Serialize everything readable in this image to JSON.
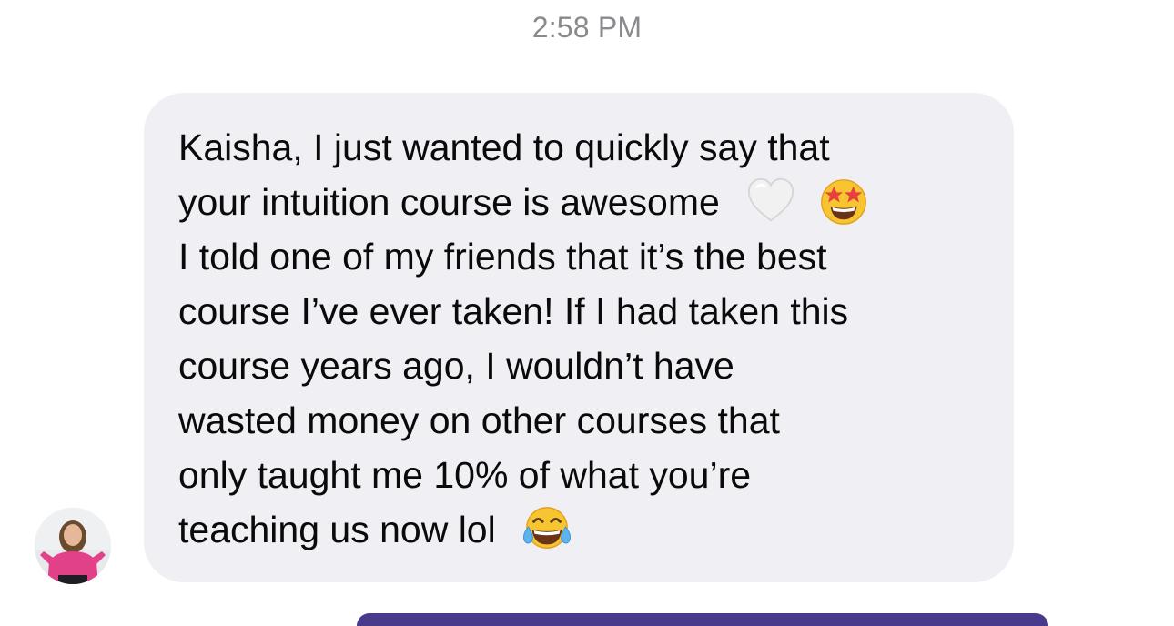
{
  "chat": {
    "timestamp": "2:58 PM",
    "message": {
      "lines": [
        "Kaisha, I just wanted to quickly say that",
        "your intuition course is awesome",
        "I told one of my friends that it’s the best",
        "course I’ve ever taken! If I had taken this",
        "course years ago, I wouldn’t have",
        "wasted money on other courses that",
        "only taught me 10% of what you’re",
        "teaching us now lol"
      ],
      "emojis": {
        "line_2": [
          "white-heart-icon",
          "star-struck-icon"
        ],
        "line_8": [
          "tears-of-joy-icon"
        ]
      }
    },
    "colors": {
      "bubble_background": "#efeff4",
      "timestamp_text": "#8a8a8e",
      "outgoing_accent": "#4a3a8c"
    }
  }
}
